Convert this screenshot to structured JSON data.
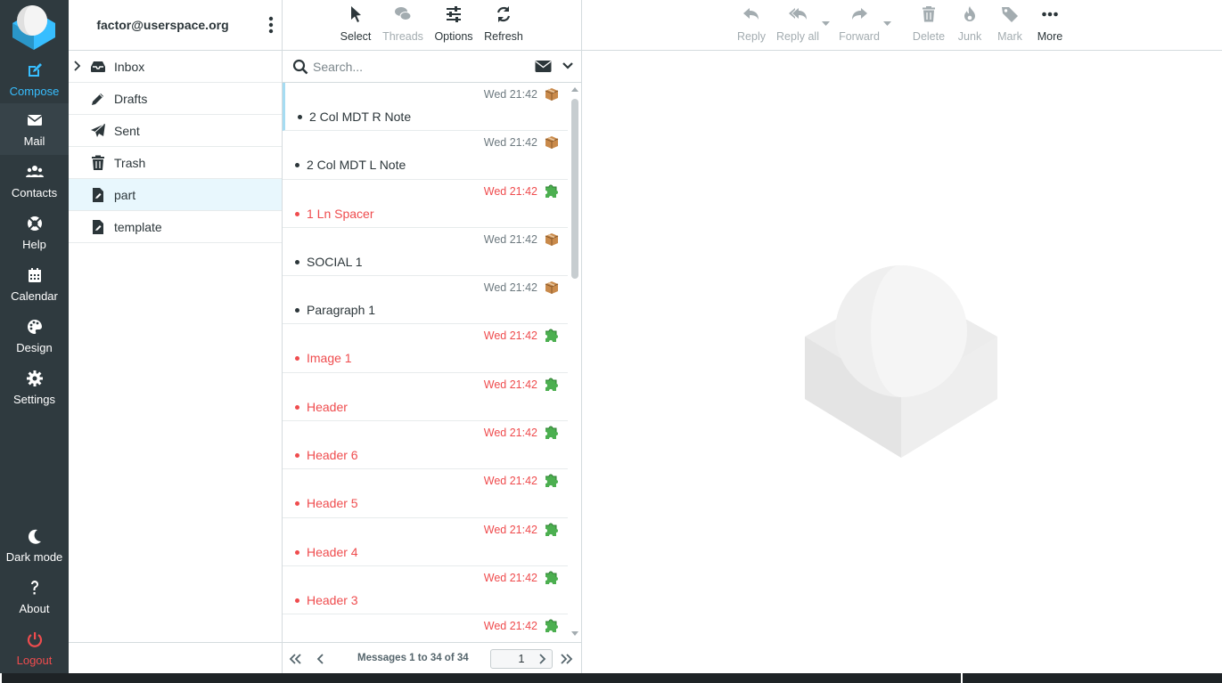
{
  "nav": {
    "compose": "Compose",
    "mail": "Mail",
    "contacts": "Contacts",
    "help": "Help",
    "calendar": "Calendar",
    "design": "Design",
    "settings": "Settings",
    "dark_mode": "Dark mode",
    "about": "About",
    "logout": "Logout"
  },
  "account": {
    "email": "factor@userspace.org"
  },
  "folders": [
    {
      "label": "Inbox",
      "icon": "inbox-icon"
    },
    {
      "label": "Drafts",
      "icon": "pencil-icon"
    },
    {
      "label": "Sent",
      "icon": "paper-plane-icon"
    },
    {
      "label": "Trash",
      "icon": "trash-icon"
    },
    {
      "label": "part",
      "icon": "file-icon",
      "selected": true
    },
    {
      "label": "template",
      "icon": "file-icon"
    }
  ],
  "list_toolbar": {
    "select": "Select",
    "threads": "Threads",
    "options": "Options",
    "refresh": "Refresh"
  },
  "search": {
    "placeholder": "Search..."
  },
  "messages": [
    {
      "date": "Wed 21:42",
      "subject": "2 Col MDT R Note",
      "unread": false,
      "icon": "package-icon"
    },
    {
      "date": "Wed 21:42",
      "subject": "2 Col MDT L Note",
      "unread": false,
      "icon": "package-icon"
    },
    {
      "date": "Wed 21:42",
      "subject": "1 Ln Spacer",
      "unread": true,
      "icon": "puzzle-icon"
    },
    {
      "date": "Wed 21:42",
      "subject": "SOCIAL 1",
      "unread": false,
      "icon": "package-icon"
    },
    {
      "date": "Wed 21:42",
      "subject": "Paragraph 1",
      "unread": false,
      "icon": "package-icon"
    },
    {
      "date": "Wed 21:42",
      "subject": "Image 1",
      "unread": true,
      "icon": "puzzle-icon"
    },
    {
      "date": "Wed 21:42",
      "subject": "Header",
      "unread": true,
      "icon": "puzzle-icon"
    },
    {
      "date": "Wed 21:42",
      "subject": "Header 6",
      "unread": true,
      "icon": "puzzle-icon"
    },
    {
      "date": "Wed 21:42",
      "subject": "Header 5",
      "unread": true,
      "icon": "puzzle-icon"
    },
    {
      "date": "Wed 21:42",
      "subject": "Header 4",
      "unread": true,
      "icon": "puzzle-icon"
    },
    {
      "date": "Wed 21:42",
      "subject": "Header 3",
      "unread": true,
      "icon": "puzzle-icon"
    },
    {
      "date": "Wed 21:42",
      "subject": "",
      "unread": true,
      "icon": "puzzle-icon"
    }
  ],
  "pager": {
    "count": "Messages 1 to 34 of 34",
    "page": "1"
  },
  "content_toolbar": {
    "reply": "Reply",
    "reply_all": "Reply all",
    "forward": "Forward",
    "delete": "Delete",
    "junk": "Junk",
    "mark": "Mark",
    "more": "More"
  },
  "colors": {
    "nav_bg": "#2f3a3f",
    "accent": "#37beff",
    "unread": "#ef4c4e",
    "selected_folder": "#e8f7fd"
  }
}
